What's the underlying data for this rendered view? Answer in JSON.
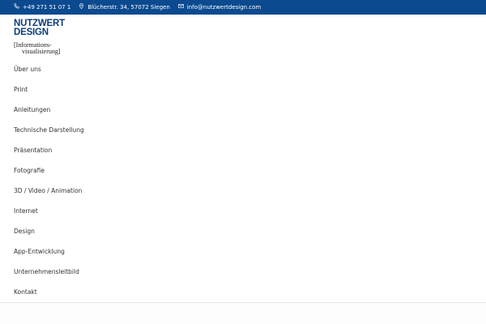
{
  "topbar": {
    "phone": "+49 271 51 07 1",
    "address": "Blücherstr. 34, 57072 Siegen",
    "email": "info@nutzwertdesign.com"
  },
  "logo": {
    "line1": "NUTZWERT",
    "line2": "DESIGN",
    "sub1": "[Informations-",
    "sub2": "visualisierung]"
  },
  "menu": {
    "items": [
      {
        "label": "Über uns"
      },
      {
        "label": "Print"
      },
      {
        "label": "Anleitungen"
      },
      {
        "label": "Technische Darstellung"
      },
      {
        "label": "Präsentation"
      },
      {
        "label": "Fotografie"
      },
      {
        "label": "3D / Video / Animation"
      },
      {
        "label": "Internet"
      },
      {
        "label": "Design"
      },
      {
        "label": "App-Entwicklung"
      },
      {
        "label": "Unternehmensleitbild"
      },
      {
        "label": "Kontakt"
      }
    ]
  },
  "colors": {
    "topbar_bg": "#0b4a8f",
    "logo_blue": "#0b3d7a",
    "menu_text": "#333333"
  },
  "icons": [
    "phone-icon",
    "map-pin-icon",
    "mail-icon"
  ]
}
